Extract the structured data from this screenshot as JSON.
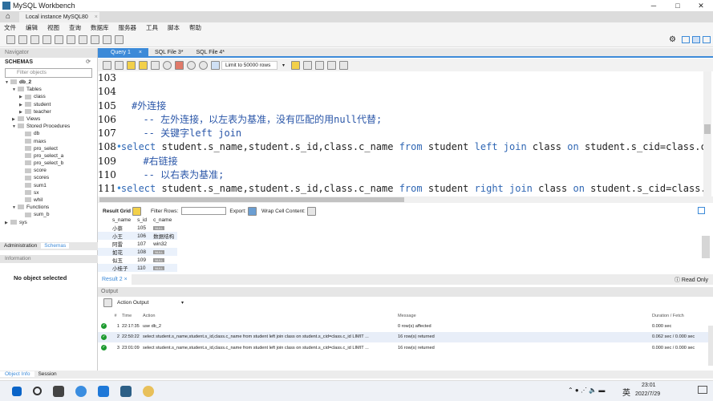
{
  "window": {
    "title": "MySQL Workbench",
    "connection_tab": "Local instance MySQL80",
    "close": "×"
  },
  "menu": [
    "文件",
    "编辑",
    "视图",
    "查询",
    "数据库",
    "服务器",
    "工具",
    "脚本",
    "帮助"
  ],
  "navigator": {
    "header": "Navigator",
    "schemas_label": "SCHEMAS",
    "filter_placeholder": "Filter objects",
    "tree": [
      {
        "label": "db_2",
        "level": 0,
        "toggle": "▼",
        "bold": true
      },
      {
        "label": "Tables",
        "level": 1,
        "toggle": "▼"
      },
      {
        "label": "class",
        "level": 2,
        "toggle": "▶"
      },
      {
        "label": "student",
        "level": 2,
        "toggle": "▶"
      },
      {
        "label": "teacher",
        "level": 2,
        "toggle": "▶"
      },
      {
        "label": "Views",
        "level": 1,
        "toggle": "▶"
      },
      {
        "label": "Stored Procedures",
        "level": 1,
        "toggle": "▼"
      },
      {
        "label": "db",
        "level": 2,
        "toggle": ""
      },
      {
        "label": "maxs",
        "level": 2,
        "toggle": ""
      },
      {
        "label": "pro_select",
        "level": 2,
        "toggle": ""
      },
      {
        "label": "pro_select_a",
        "level": 2,
        "toggle": ""
      },
      {
        "label": "pro_select_b",
        "level": 2,
        "toggle": ""
      },
      {
        "label": "score",
        "level": 2,
        "toggle": ""
      },
      {
        "label": "scores",
        "level": 2,
        "toggle": ""
      },
      {
        "label": "sum1",
        "level": 2,
        "toggle": ""
      },
      {
        "label": "sx",
        "level": 2,
        "toggle": ""
      },
      {
        "label": "whil",
        "level": 2,
        "toggle": ""
      },
      {
        "label": "Functions",
        "level": 1,
        "toggle": "▼"
      },
      {
        "label": "sum_b",
        "level": 2,
        "toggle": ""
      },
      {
        "label": "sys",
        "level": 0,
        "toggle": "▶"
      }
    ],
    "tabs": [
      "Administration",
      "Schemas"
    ],
    "info_header": "Information",
    "info_text": "No object selected"
  },
  "query_tabs": [
    "Query 1",
    "SQL File 3*",
    "SQL File 4*"
  ],
  "editor": {
    "limit": "Limit to 50000 rows",
    "lines": [
      {
        "n": "103",
        "dot": false,
        "text": ""
      },
      {
        "n": "104",
        "dot": false,
        "text": ""
      },
      {
        "n": "105",
        "dot": false,
        "text": "#外连接",
        "cls": "cm",
        "indent": ""
      },
      {
        "n": "106",
        "dot": false,
        "text": "-- 左外连接，以左表为基准，没有匹配的用null代替;",
        "cls": "cm",
        "indent": "  "
      },
      {
        "n": "107",
        "dot": false,
        "text": "-- 关键字left join",
        "cls": "cm",
        "indent": "  "
      },
      {
        "n": "108",
        "dot": true,
        "text": "select student.s_name,student.s_id,class.c_name from student left join class on student.s_cid=class.c_id",
        "cls": "",
        "indent": ""
      },
      {
        "n": "109",
        "dot": false,
        "text": "#右链接",
        "cls": "cm",
        "indent": "  "
      },
      {
        "n": "110",
        "dot": false,
        "text": "-- 以右表为基准;",
        "cls": "cm",
        "indent": "  "
      },
      {
        "n": "111",
        "dot": true,
        "text": "select student.s_name,student.s_id,class.c_name from student right join class on student.s_cid=class.c_id",
        "cls": "",
        "indent": ""
      }
    ]
  },
  "result": {
    "grid_label": "Result Grid",
    "filter_label": "Filter Rows:",
    "export_label": "Export:",
    "wrap_label": "Wrap Cell Content:",
    "columns": [
      "s_name",
      "s_id",
      "c_name"
    ],
    "rows": [
      [
        "小蔡",
        "105",
        "NULL"
      ],
      [
        "小王",
        "106",
        "数据结构"
      ],
      [
        "阿雷",
        "107",
        "win32"
      ],
      [
        "如花",
        "108",
        "NULL"
      ],
      [
        "似玉",
        "109",
        "NULL"
      ],
      [
        "小桂子",
        "110",
        "NULL"
      ]
    ],
    "tab": "Result 2",
    "readonly": "Read Only"
  },
  "output": {
    "header": "Output",
    "selector": "Action Output",
    "columns": [
      "#",
      "Time",
      "Action",
      "Message",
      "Duration / Fetch"
    ],
    "rows": [
      {
        "n": "1",
        "time": "22:17:35",
        "action": "use db_2",
        "message": "0 row(s) affected",
        "duration": "0.000 sec"
      },
      {
        "n": "2",
        "time": "22:50:22",
        "action": "select student.s_name,student.s_id,class.c_name from student left join class on student.s_cid=class.c_id LIMIT ...",
        "message": "16 row(s) returned",
        "duration": "0.062 sec / 0.000 sec"
      },
      {
        "n": "3",
        "time": "23:01:09",
        "action": "select student.s_name,student.s_id,class.c_name from student left join class on student.s_cid=class.c_id LIMIT ...",
        "message": "16 row(s) returned",
        "duration": "0.000 sec / 0.000 sec"
      }
    ]
  },
  "bottom_tabs": [
    "Object Info",
    "Session"
  ],
  "taskbar": {
    "lang": "英",
    "time": "23:01",
    "date": "2022/7/29"
  },
  "colors": {
    "accent": "#3c8ad8",
    "ok": "#1c9a2e",
    "keyword": "#3067b4"
  }
}
